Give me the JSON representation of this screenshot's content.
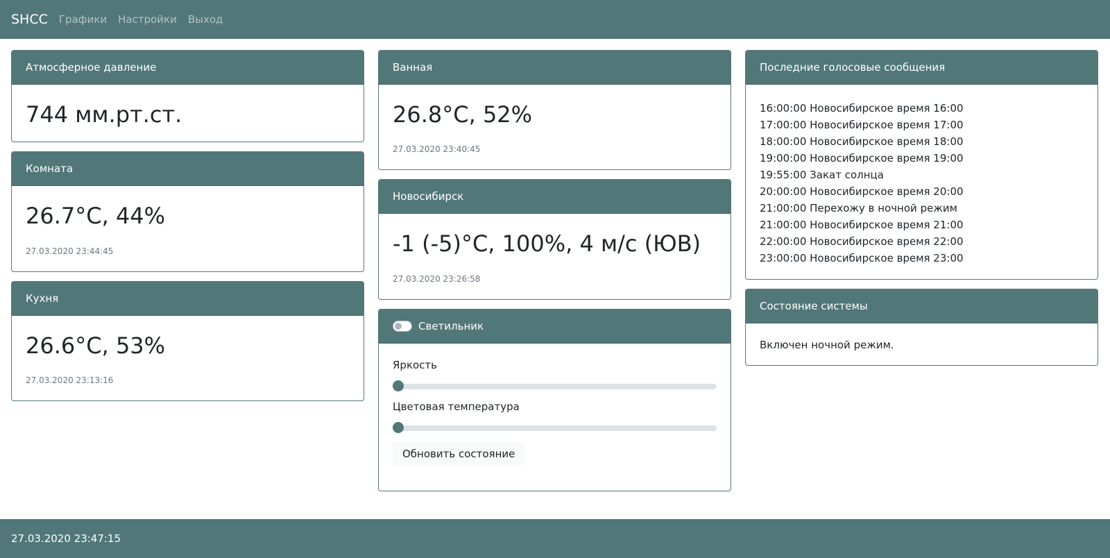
{
  "navbar": {
    "brand": "SHCC",
    "links": [
      "Графики",
      "Настройки",
      "Выход"
    ]
  },
  "pressure": {
    "title": "Атмосферное давление",
    "value": "744 мм.рт.ст."
  },
  "room": {
    "title": "Комната",
    "value": "26.7°C, 44%",
    "timestamp": "27.03.2020 23:44:45"
  },
  "kitchen": {
    "title": "Кухня",
    "value": "26.6°C, 53%",
    "timestamp": "27.03.2020 23:13:16"
  },
  "bathroom": {
    "title": "Ванная",
    "value": "26.8°C, 52%",
    "timestamp": "27.03.2020 23:40:45"
  },
  "novosibirsk": {
    "title": "Новосибирск",
    "value": "-1 (-5)°C, 100%, 4 м/с (ЮВ)",
    "timestamp": "27.03.2020 23:26:58"
  },
  "lamp": {
    "title": "Светильник",
    "enabled": false,
    "brightness_label": "Яркость",
    "brightness_value": 0,
    "color_temp_label": "Цветовая температура",
    "color_temp_value": 0,
    "refresh_button": "Обновить состояние"
  },
  "voice": {
    "title": "Последние голосовые сообщения",
    "messages": [
      "16:00:00 Новосибирское время 16:00",
      "17:00:00 Новосибирское время 17:00",
      "18:00:00 Новосибирское время 18:00",
      "19:00:00 Новосибирское время 19:00",
      "19:55:00 Закат солнца",
      "20:00:00 Новосибирское время 20:00",
      "21:00:00 Перехожу в ночной режим",
      "21:00:00 Новосибирское время 21:00",
      "22:00:00 Новосибирское время 22:00",
      "23:00:00 Новосибирское время 23:00"
    ]
  },
  "system": {
    "title": "Состояние системы",
    "status": "Включен ночной режим."
  },
  "footer": {
    "datetime": "27.03.2020 23:47:15"
  },
  "colors": {
    "accent": "#527778",
    "track": "#dee2e6",
    "muted": "#6c757d"
  }
}
